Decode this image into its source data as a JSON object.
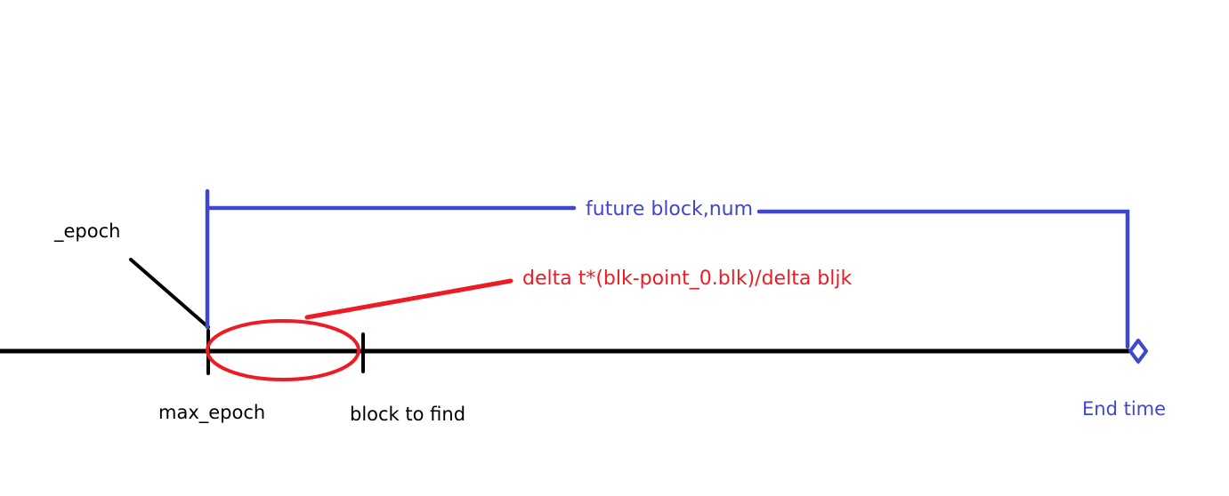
{
  "labels": {
    "epoch": "_epoch",
    "max_epoch": "max_epoch",
    "block_to_find": "block to find",
    "future_block_num": "future block,num",
    "formula": "delta t*(blk-point_0.blk)/delta bljk",
    "end_time": "End time"
  },
  "colors": {
    "timeline": "#000000",
    "span": "#3f48cc",
    "highlight": "#ed1c24"
  }
}
